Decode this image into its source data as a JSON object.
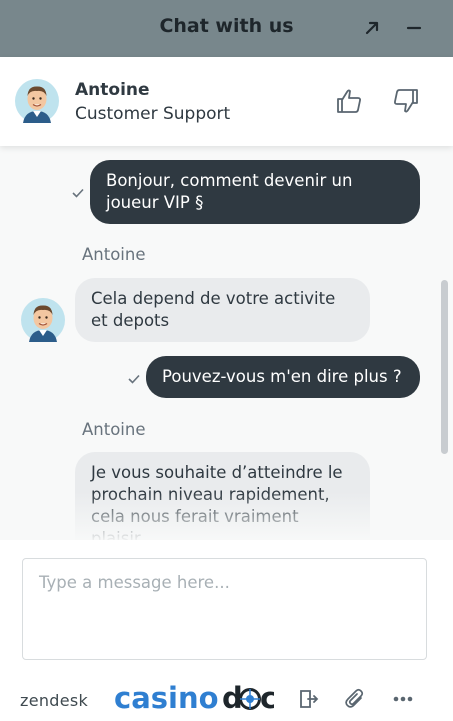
{
  "window": {
    "title": "Chat with us",
    "popout_icon": "arrow-up-right-icon",
    "minimize_icon": "minus-icon"
  },
  "agent": {
    "name": "Antoine",
    "role": "Customer Support",
    "rating_up_icon": "thumbs-up-icon",
    "rating_down_icon": "thumbs-down-icon"
  },
  "messages": [
    {
      "from": "visitor",
      "text": "Bonjour, comment devenir un joueur VIP §",
      "status_icon": "check-icon"
    },
    {
      "from": "agent",
      "sender": "Antoine",
      "text": "Cela depend de votre activite et depots"
    },
    {
      "from": "visitor",
      "text": "Pouvez-vous m'en dire plus ?",
      "status_icon": "check-icon"
    },
    {
      "from": "agent",
      "sender": "Antoine",
      "text": "Je vous souhaite d’atteindre le prochain niveau rapidement, cela nous ferait vraiment plaisir."
    }
  ],
  "composer": {
    "placeholder": "Type a message here...",
    "value": ""
  },
  "footer": {
    "brand_text": "zendesk",
    "logo_text": "casinodoc",
    "actions": [
      "end-chat-icon",
      "paperclip-icon",
      "more-icon"
    ]
  },
  "colors": {
    "header_bg": "#78878c",
    "outgoing_bubble": "#2f3941",
    "incoming_bubble": "#e9ebed",
    "logo_blue": "#2f7fd1"
  }
}
